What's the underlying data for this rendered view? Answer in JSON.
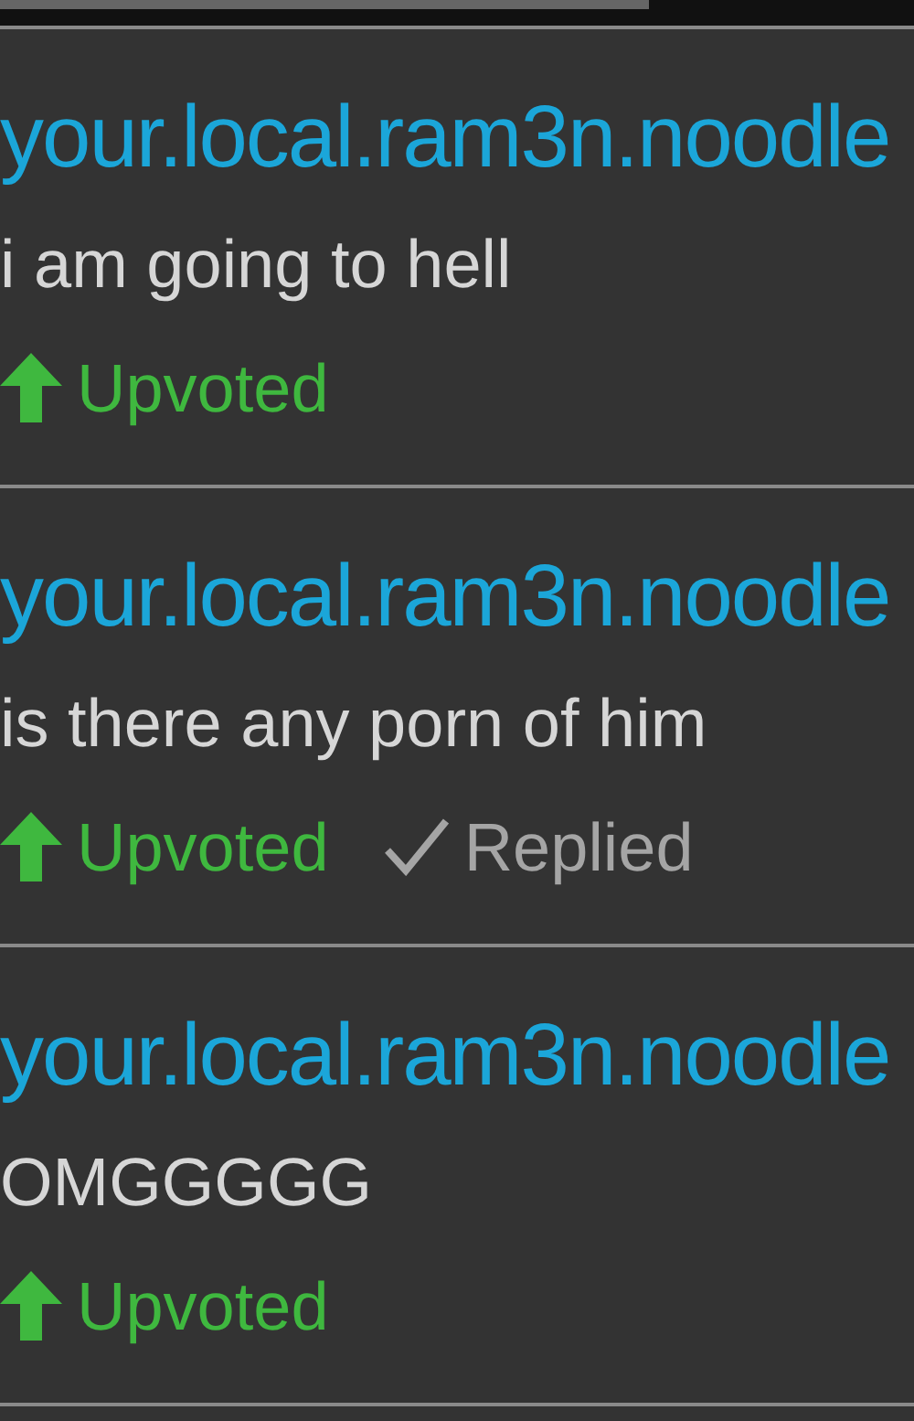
{
  "comments": [
    {
      "username": "your.local.ram3n.noodle",
      "text": "i am going to hell",
      "actions": [
        {
          "kind": "upvote",
          "label": "Upvoted"
        }
      ]
    },
    {
      "username": "your.local.ram3n.noodle",
      "text": "is there any porn of him",
      "actions": [
        {
          "kind": "upvote",
          "label": "Upvoted"
        },
        {
          "kind": "reply",
          "label": "Replied"
        }
      ]
    },
    {
      "username": "your.local.ram3n.noodle",
      "text": "OMGGGGG",
      "actions": [
        {
          "kind": "upvote",
          "label": "Upvoted"
        }
      ]
    }
  ]
}
